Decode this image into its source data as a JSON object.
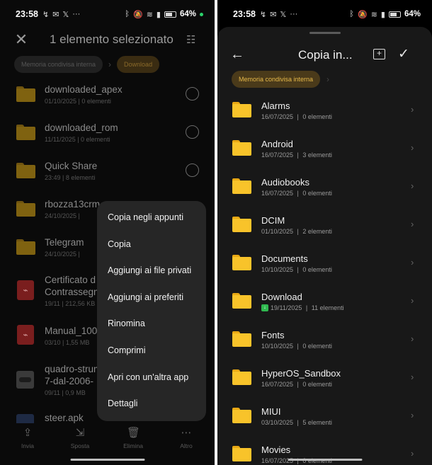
{
  "status": {
    "time": "23:58",
    "battery": "64%"
  },
  "left": {
    "title": "1 elemento selezionato",
    "breadcrumbs": [
      "Memoria condivisa interna",
      "Download"
    ],
    "files": [
      {
        "name": "downloaded_apex",
        "meta": "01/10/2025  |  0 elementi",
        "icon": "folder-icon",
        "selectable": true
      },
      {
        "name": "downloaded_rom",
        "meta": "11/11/2025  |  0 elementi",
        "icon": "folder-icon",
        "selectable": true
      },
      {
        "name": "Quick Share",
        "meta": "23:49  |  8 elementi",
        "icon": "folder-icon",
        "selectable": true
      },
      {
        "name": "rbozza13crm",
        "meta": "24/10/2025  |  ",
        "icon": "folder-icon",
        "selectable": false
      },
      {
        "name": "Telegram",
        "meta": "24/10/2025  |  ",
        "icon": "folder-icon",
        "selectable": false
      },
      {
        "name": "Certificato d",
        "name2": "Contrassegno",
        "meta": "19/11  |  212,56 KB",
        "icon": "pdf-icon",
        "selectable": false
      },
      {
        "name": "Manual_100c",
        "meta": "03/10  |  1,55 MB",
        "icon": "pdf-icon",
        "selectable": false
      },
      {
        "name": "quadro-strum",
        "name2": "7-dal-2006-",
        "meta": "09/11  |  0,9 MB",
        "icon": "image-thumb-icon",
        "selectable": false
      },
      {
        "name": "steer.apk",
        "meta": "",
        "icon": "apk-icon",
        "selectable": false
      }
    ],
    "context_menu": [
      "Copia negli appunti",
      "Copia",
      "Aggiungi ai file privati",
      "Aggiungi ai preferiti",
      "Rinomina",
      "Comprimi",
      "Apri con un'altra app",
      "Dettagli"
    ],
    "bottom_bar": [
      {
        "label": "Invia",
        "icon": "share-icon"
      },
      {
        "label": "Sposta",
        "icon": "move-icon"
      },
      {
        "label": "Elimina",
        "icon": "trash-icon"
      },
      {
        "label": "Altro",
        "icon": "more-icon"
      }
    ]
  },
  "right": {
    "title": "Copia in...",
    "breadcrumbs": [
      "Memoria condivisa interna"
    ],
    "folders": [
      {
        "name": "Alarms",
        "date": "16/07/2025",
        "count": "0 elementi"
      },
      {
        "name": "Android",
        "date": "16/07/2025",
        "count": "3 elementi"
      },
      {
        "name": "Audiobooks",
        "date": "16/07/2025",
        "count": "0 elementi"
      },
      {
        "name": "DCIM",
        "date": "01/10/2025",
        "count": "2 elementi"
      },
      {
        "name": "Documents",
        "date": "10/10/2025",
        "count": "0 elementi"
      },
      {
        "name": "Download",
        "date": "19/11/2025",
        "count": "11 elementi",
        "badge": true
      },
      {
        "name": "Fonts",
        "date": "10/10/2025",
        "count": "0 elementi"
      },
      {
        "name": "HyperOS_Sandbox",
        "date": "16/07/2025",
        "count": "0 elementi"
      },
      {
        "name": "MIUI",
        "date": "03/10/2025",
        "count": "5 elementi"
      },
      {
        "name": "Movies",
        "date": "16/07/2025",
        "count": "0 elementi"
      }
    ]
  }
}
